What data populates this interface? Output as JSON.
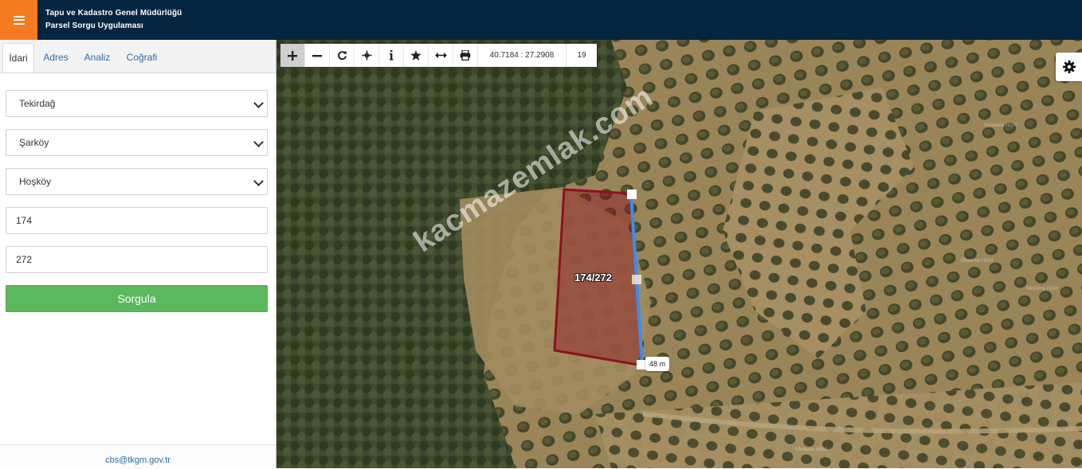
{
  "header": {
    "menu_icon": "hamburger-icon",
    "title_line1": "Tapu ve Kadastro Genel Müdürlüğü",
    "title_line2": "Parsel Sorgu Uygulaması",
    "colors": {
      "bar": "#04253f",
      "menu": "#f47b20"
    }
  },
  "sidebar": {
    "tabs": [
      {
        "label": "İdari",
        "active": true
      },
      {
        "label": "Adres",
        "active": false
      },
      {
        "label": "Analiz",
        "active": false
      },
      {
        "label": "Coğrafi",
        "active": false
      }
    ],
    "form": {
      "province": "Tekirdağ",
      "district": "Şarköy",
      "neighborhood": "Hoşköy",
      "block": "174",
      "parcel": "272",
      "submit_label": "Sorgula"
    },
    "footer_email": "cbs@tkgm.gov.tr"
  },
  "map": {
    "toolbar": {
      "tools": [
        "plus-icon",
        "minus-icon",
        "refresh-icon",
        "pan-icon",
        "info-icon",
        "star-icon",
        "measure-icon",
        "print-icon"
      ],
      "active_tool": "plus-icon",
      "coordinates": "40.7184 : 27.2908",
      "zoom": "19"
    },
    "settings_icon": "gear-icon",
    "parcel_label": "174/272",
    "measure_label": "48 m",
    "watermark": "kacmazemlak.com",
    "imagery_labels": [
      "Sifreleme HGM",
      "Sifreleme HGM",
      "Sifreleme HGM",
      "Sifreleme HGM"
    ]
  }
}
